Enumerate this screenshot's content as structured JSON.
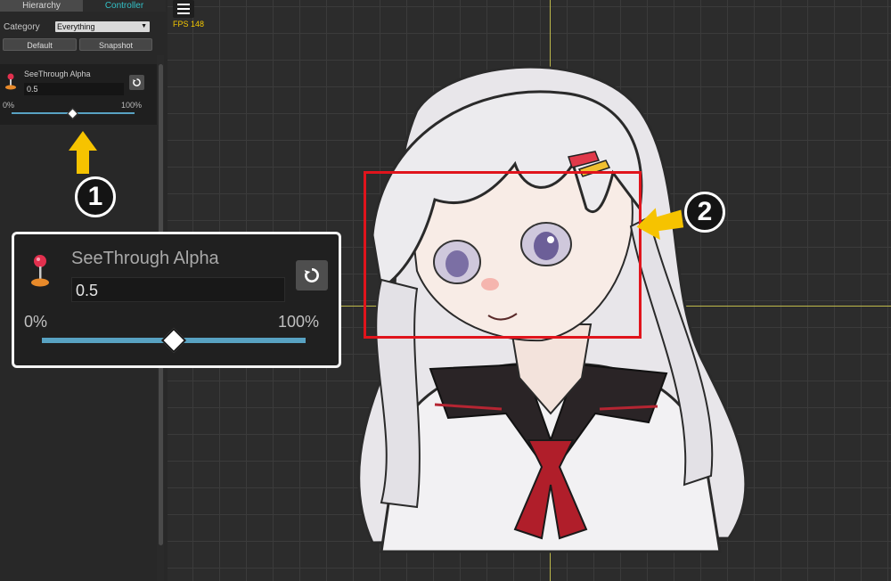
{
  "panel": {
    "tabs": [
      "Hierarchy",
      "Controller"
    ],
    "category_label": "Category",
    "category_value": "Everything",
    "default_button": "Default",
    "snapshot_button": "Snapshot",
    "param": {
      "name": "SeeThrough Alpha",
      "value": "0.5",
      "min_label": "0%",
      "max_label": "100%",
      "slider_level": 0.5
    }
  },
  "viewport": {
    "fps_text": "FPS 148"
  },
  "callouts": {
    "badge_1": "1",
    "badge_2": "2"
  },
  "colors": {
    "accent_tab": "#33c1c7",
    "slider": "#58a2c2",
    "arrow": "#f6c300",
    "highlight_box": "#e0141c",
    "axis": "#bdb84a"
  },
  "icons": [
    "menu-icon",
    "joystick-icon",
    "reset-icon",
    "arrow-up-icon",
    "arrow-left-icon"
  ]
}
